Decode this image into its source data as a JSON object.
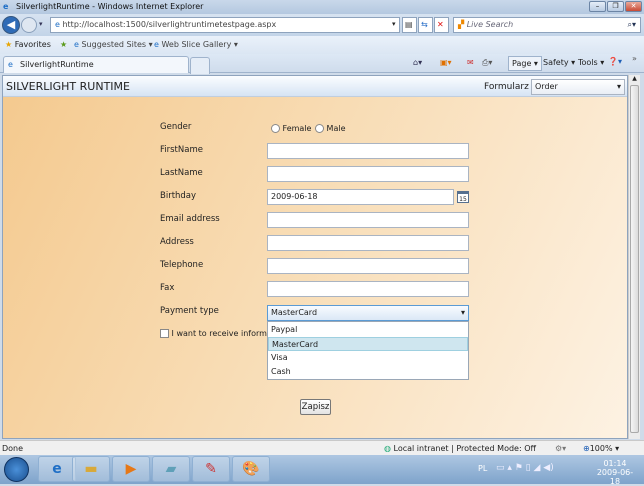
{
  "window": {
    "title": "SilverlightRuntime - Windows Internet Explorer"
  },
  "address": {
    "url": "http://localhost:1500/silverlightruntimetestpage.aspx",
    "search_placeholder": "Live Search"
  },
  "favorites": {
    "favorites_label": "Favorites",
    "suggested": "Suggested Sites ▾",
    "webslice": "Web Slice Gallery ▾"
  },
  "tab": {
    "label": "SilverlightRuntime"
  },
  "commandbar": {
    "page": "Page ▾",
    "safety": "Safety ▾",
    "tools": "Tools ▾"
  },
  "app": {
    "title": "SILVERLIGHT RUNTIME",
    "form_label": "Formularz",
    "form_select": "Order"
  },
  "form": {
    "gender_label": "Gender",
    "female": "Female",
    "male": "Male",
    "firstname_label": "FirstName",
    "firstname": "",
    "lastname_label": "LastName",
    "lastname": "",
    "birthday_label": "Birthday",
    "birthday": "2009-06-18",
    "calendar_day": "15",
    "email_label": "Email address",
    "email": "",
    "address_label": "Address",
    "address": "",
    "telephone_label": "Telephone",
    "telephone": "",
    "fax_label": "Fax",
    "fax": "",
    "payment_label": "Payment type",
    "payment_value": "MasterCard",
    "payment_options": [
      "Paypal",
      "MasterCard",
      "Visa",
      "Cash"
    ],
    "newsletter_label": "I want to receive informatio",
    "submit": "Zapisz"
  },
  "status": {
    "text": "Done",
    "zone": "Local intranet | Protected Mode: Off",
    "zoom": "100%"
  },
  "taskbar": {
    "lang": "PL",
    "time": "01:14",
    "date": "2009-06-18"
  }
}
